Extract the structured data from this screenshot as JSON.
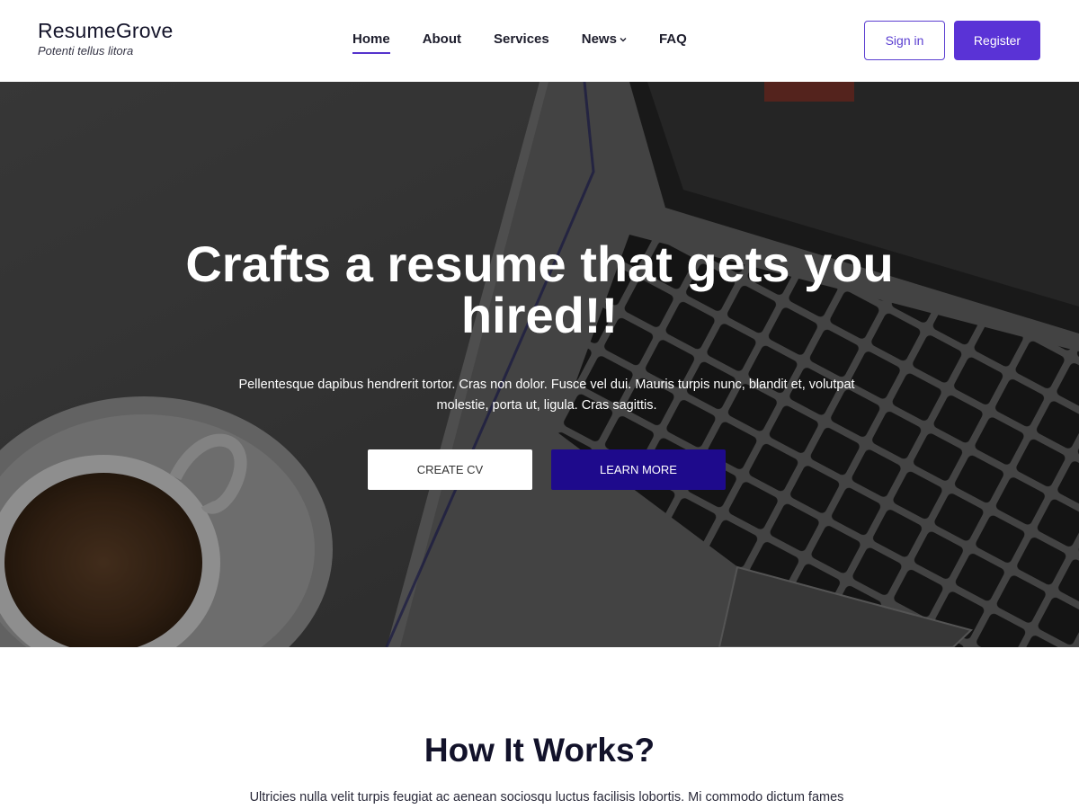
{
  "brand": {
    "name": "ResumeGrove",
    "tagline": "Potenti tellus litora"
  },
  "nav": {
    "items": [
      {
        "label": "Home",
        "active": true
      },
      {
        "label": "About"
      },
      {
        "label": "Services"
      },
      {
        "label": "News",
        "dropdown": true
      },
      {
        "label": "FAQ"
      }
    ]
  },
  "auth": {
    "signin_label": "Sign in",
    "register_label": "Register"
  },
  "hero": {
    "title": "Crafts a resume that gets you hired!!",
    "text": "Pellentesque dapibus hendrerit tortor. Cras non dolor. Fusce vel dui. Mauris turpis nunc, blandit et, volutpat molestie, porta ut, ligula. Cras sagittis.",
    "create_label": "CREATE CV",
    "learn_label": "LEARN MORE"
  },
  "how": {
    "title": "How It Works?",
    "text": "Ultricies nulla velit turpis feugiat ac aenean sociosqu luctus facilisis lobortis. Mi commodo dictum fames"
  },
  "colors": {
    "accent": "#5a33d6",
    "learn_button": "#1e0a8c",
    "heading": "#12122a"
  }
}
